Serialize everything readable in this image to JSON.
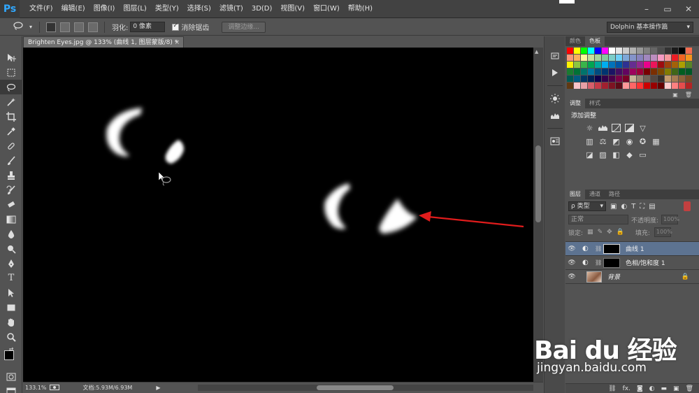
{
  "app": {
    "logo": "Ps"
  },
  "menu": [
    "文件(F)",
    "编辑(E)",
    "图像(I)",
    "图层(L)",
    "类型(Y)",
    "选择(S)",
    "滤镜(T)",
    "3D(D)",
    "视图(V)",
    "窗口(W)",
    "帮助(H)"
  ],
  "window_controls": {
    "minimize": "–",
    "restore": "▭",
    "close": "✕"
  },
  "options": {
    "feather_label": "羽化:",
    "feather_value": "0 像素",
    "antialias_label": "消除锯齿",
    "refine_edge_label": "调整边缘...",
    "workspace": "Dolphin 基本操作篇"
  },
  "document": {
    "tab_title": "Brighten Eyes.jpg @ 133% (曲线 1, 图层蒙版/8) *",
    "close": "×"
  },
  "status": {
    "zoom": "133.1%",
    "doc_size": "文档:5.93M/6.93M",
    "arrow": "▶"
  },
  "panels": {
    "color_tab": "颜色",
    "swatches_tab": "色板",
    "adjustments_tab": "调整",
    "styles_tab": "样式",
    "add_adjustment": "添加调整",
    "layers_tab": "图层",
    "channels_tab": "通道",
    "paths_tab": "路径",
    "filter_kind": "ρ 类型",
    "blend_mode": "正常",
    "opacity_label": "不透明度:",
    "opacity_value": "100%",
    "lock_label": "锁定:",
    "fill_label": "填充:",
    "fill_value": "100%"
  },
  "layers": [
    {
      "name": "曲线 1",
      "selected": true
    },
    {
      "name": "色相/饱和度 1",
      "selected": false
    },
    {
      "name": "背景",
      "selected": false
    }
  ],
  "swatch_colors": [
    "#ff0000",
    "#ffff00",
    "#00ff00",
    "#00ffff",
    "#0000ff",
    "#ff00ff",
    "#ffffff",
    "#e6e6e6",
    "#cccccc",
    "#b3b3b3",
    "#999999",
    "#808080",
    "#666666",
    "#4d4d4d",
    "#333333",
    "#1a1a1a",
    "#000000",
    "#f26c4f",
    "#f7977a",
    "#fbaf5d",
    "#fff79a",
    "#c4df9b",
    "#a3d39c",
    "#82ca9d",
    "#7bcdc8",
    "#6ecff6",
    "#7ea7d8",
    "#8493ca",
    "#8882be",
    "#a187be",
    "#bc8dbf",
    "#f49ac2",
    "#f6989d",
    "#ed1c24",
    "#f26522",
    "#f7941d",
    "#fff200",
    "#8dc63f",
    "#39b54a",
    "#00a651",
    "#00a99d",
    "#00aeef",
    "#0072bc",
    "#0054a6",
    "#2e3192",
    "#662d91",
    "#92278f",
    "#ec008c",
    "#ed145b",
    "#9e0b0f",
    "#a0410d",
    "#a36209",
    "#aba000",
    "#598527",
    "#1a7b30",
    "#007236",
    "#00746b",
    "#0076a3",
    "#004b80",
    "#003471",
    "#1b1464",
    "#440e62",
    "#630460",
    "#9e005d",
    "#9e0039",
    "#790000",
    "#7b2e00",
    "#7d4900",
    "#827b00",
    "#406618",
    "#005e20",
    "#005826",
    "#005952",
    "#005b7f",
    "#003663",
    "#002157",
    "#0d004c",
    "#32004b",
    "#4b0049",
    "#7b0046",
    "#7a0026",
    "#c7b299",
    "#998675",
    "#736357",
    "#534741",
    "#37302d",
    "#c69c6d",
    "#a67c52",
    "#8c6239",
    "#754c24",
    "#603913",
    "#f9c4c9",
    "#e8a0a6",
    "#d65f6b",
    "#c53a48",
    "#a1202f",
    "#7e1322",
    "#5c0b17",
    "#ff9999",
    "#ff6666",
    "#ff3333",
    "#cc0000",
    "#990000",
    "#660000",
    "#ffcccc",
    "#ff8080",
    "#e64d4d",
    "#b32424"
  ],
  "watermark": {
    "main": "Bai du 经验",
    "url": "jingyan.baidu.com"
  }
}
